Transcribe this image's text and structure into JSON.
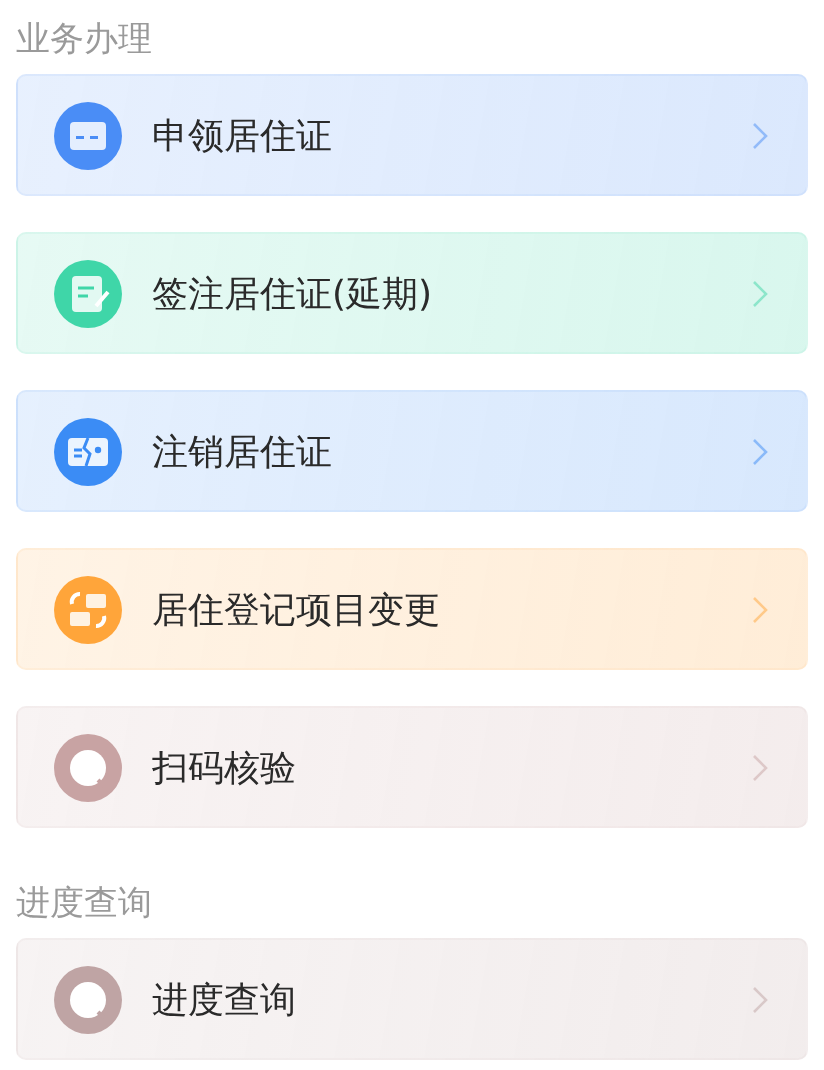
{
  "sections": [
    {
      "title": "业务办理",
      "items": [
        {
          "label": "申领居住证",
          "kind": "card",
          "color": "#4a8df6"
        },
        {
          "label": "签注居住证(延期)",
          "kind": "sign",
          "color": "#3fd6a8"
        },
        {
          "label": "注销居住证",
          "kind": "cancel",
          "color": "#3b8cf5"
        },
        {
          "label": "居住登记项目变更",
          "kind": "swap",
          "color": "#ffa53a"
        },
        {
          "label": "扫码核验",
          "kind": "scan",
          "color": "#c8a3a3"
        }
      ]
    },
    {
      "title": "进度查询",
      "items": [
        {
          "label": "进度查询",
          "kind": "scan",
          "color": "#bfa4a4"
        }
      ]
    }
  ]
}
